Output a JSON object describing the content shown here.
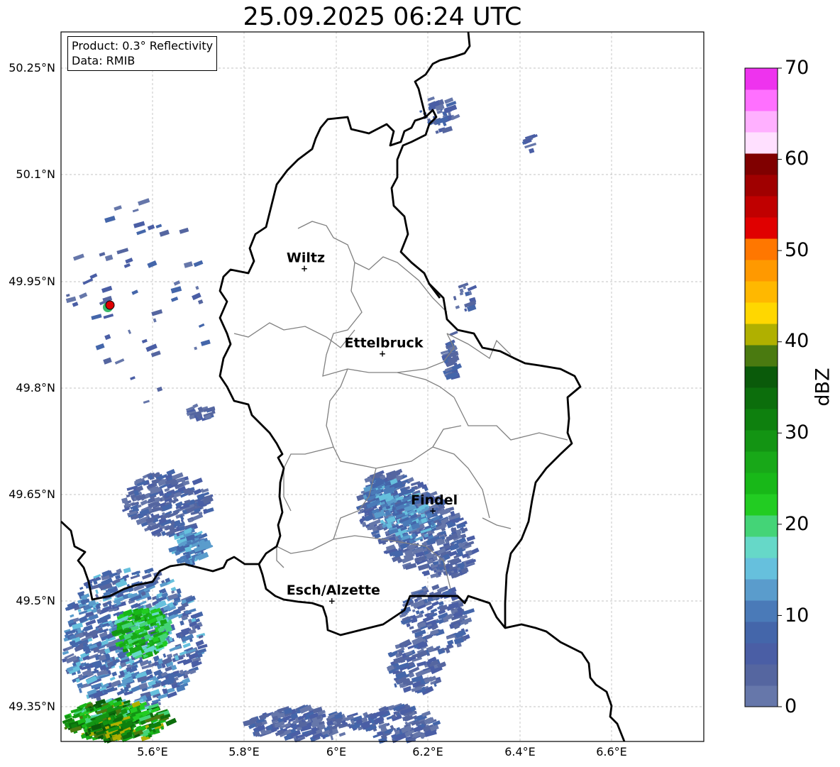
{
  "title": "25.09.2025 06:24 UTC",
  "infobox": {
    "product": "Product: 0.3° Reflectivity",
    "data": "Data: RMIB"
  },
  "y_ticks": [
    "50.25°N",
    "50.1°N",
    "49.95°N",
    "49.8°N",
    "49.65°N",
    "49.5°N",
    "49.35°N"
  ],
  "x_ticks": [
    "5.6°E",
    "5.8°E",
    "6°E",
    "6.2°E",
    "6.4°E",
    "6.6°E"
  ],
  "cities": [
    {
      "name": "Wiltz",
      "lon": 5.93,
      "lat": 49.968
    },
    {
      "name": "Ettelbruck",
      "lon": 6.1,
      "lat": 49.848
    },
    {
      "name": "Findel",
      "lon": 6.21,
      "lat": 49.627
    },
    {
      "name": "Esch/Alzette",
      "lon": 5.99,
      "lat": 49.5
    }
  ],
  "colorbar": {
    "label": "dBZ",
    "min": 0,
    "max": 70,
    "ticks": [
      "0",
      "10",
      "20",
      "30",
      "40",
      "50",
      "60",
      "70"
    ],
    "colors": [
      "#6677aa",
      "#5566a0",
      "#4a5ea5",
      "#4466aa",
      "#4a7ab8",
      "#5a9ccc",
      "#66c0dd",
      "#66d8c8",
      "#44d477",
      "#22cc22",
      "#18b818",
      "#18a818",
      "#139413",
      "#0e800e",
      "#0c6e0c",
      "#0a5a0a",
      "#4a7a10",
      "#b0b000",
      "#ffd700",
      "#ffb800",
      "#ff9900",
      "#ff7700",
      "#e00000",
      "#c00000",
      "#a00000",
      "#800000",
      "#ffe0ff",
      "#ffb0ff",
      "#ff70ff",
      "#ee33ee"
    ]
  },
  "colors": {
    "border": "#000000",
    "cantons": "#808080",
    "grid": "#b0b0b0",
    "radar_site": "#e00000"
  }
}
